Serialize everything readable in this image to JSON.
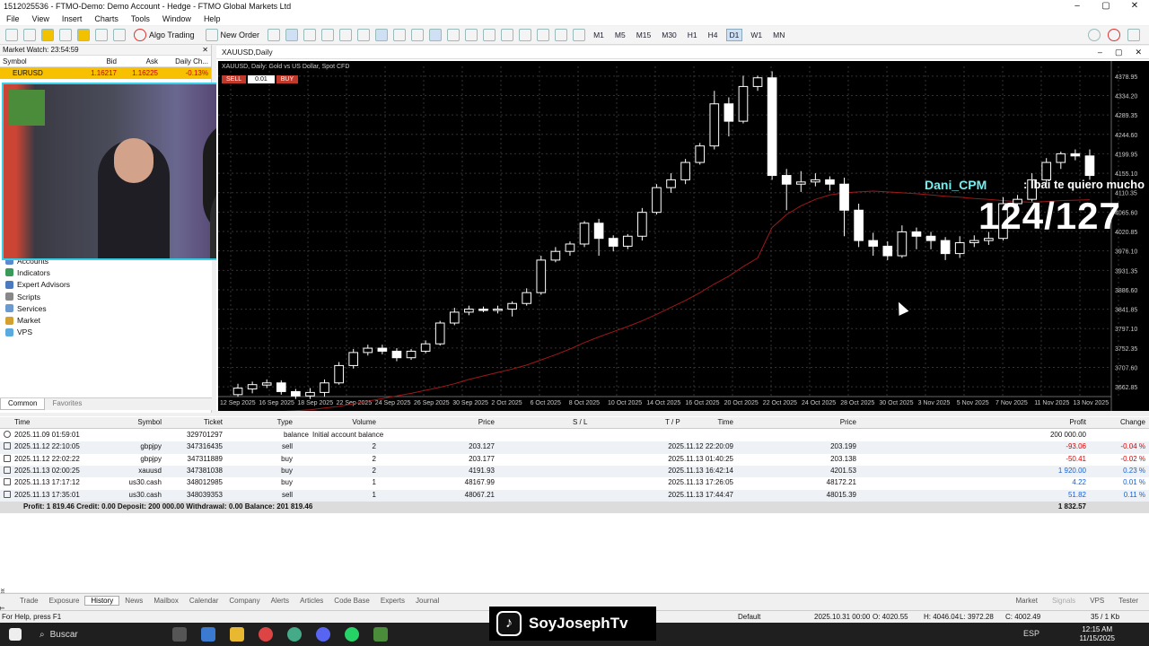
{
  "window": {
    "title": "1512025536 - FTMO-Demo: Demo Account - Hedge - FTMO Global Markets Ltd"
  },
  "menu": [
    "File",
    "View",
    "Insert",
    "Charts",
    "Tools",
    "Window",
    "Help"
  ],
  "toolbar": {
    "algo_label": "Algo Trading",
    "neworder_label": "New Order",
    "timeframes": [
      "M1",
      "M5",
      "M15",
      "M30",
      "H1",
      "H4",
      "D1",
      "W1",
      "MN"
    ],
    "active_tf": "D1"
  },
  "market_watch": {
    "header": "Market Watch: 23:54:59",
    "cols": [
      "Symbol",
      "Bid",
      "Ask",
      "Daily Ch..."
    ],
    "row": {
      "symbol": "EURUSD",
      "bid": "1.16217",
      "ask": "1.16225",
      "change": "-0.13%"
    }
  },
  "navigator": {
    "items": [
      "Accounts",
      "Indicators",
      "Expert Advisors",
      "Scripts",
      "Services",
      "Market",
      "VPS"
    ],
    "tabs": [
      "Common",
      "Favorites"
    ]
  },
  "chart_window": {
    "tab": "XAUUSD,Daily",
    "desc": "XAUUSD, Daily: Gold vs US Dollar, Spot CFD",
    "sell": "SELL",
    "buy": "BUY",
    "lot": "0.01"
  },
  "chart_data": {
    "type": "candlestick",
    "symbol": "XAUUSD",
    "x_labels": [
      "12 Sep 2025",
      "16 Sep 2025",
      "18 Sep 2025",
      "22 Sep 2025",
      "24 Sep 2025",
      "26 Sep 2025",
      "30 Sep 2025",
      "2 Oct 2025",
      "6 Oct 2025",
      "8 Oct 2025",
      "10 Oct 2025",
      "14 Oct 2025",
      "16 Oct 2025",
      "20 Oct 2025",
      "22 Oct 2025",
      "24 Oct 2025",
      "28 Oct 2025",
      "30 Oct 2025",
      "3 Nov 2025",
      "5 Nov 2025",
      "7 Nov 2025",
      "11 Nov 2025",
      "13 Nov 2025"
    ],
    "y_labels": [
      "4378.95",
      "4334.20",
      "4289.35",
      "4244.60",
      "4199.95",
      "4155.10",
      "4110.35",
      "4065.60",
      "4020.85",
      "3976.10",
      "3931.35",
      "3886.60",
      "3841.85",
      "3797.10",
      "3752.35",
      "3707.60",
      "3662.85"
    ],
    "ylim": [
      3640.48,
      4401.33
    ],
    "candles": [
      [
        3645,
        3660,
        3640,
        3670
      ],
      [
        3658,
        3668,
        3648,
        3675
      ],
      [
        3667,
        3672,
        3660,
        3680
      ],
      [
        3672,
        3652,
        3645,
        3678
      ],
      [
        3652,
        3642,
        3635,
        3658
      ],
      [
        3642,
        3650,
        3635,
        3660
      ],
      [
        3650,
        3672,
        3640,
        3680
      ],
      [
        3672,
        3712,
        3668,
        3720
      ],
      [
        3712,
        3742,
        3705,
        3750
      ],
      [
        3742,
        3752,
        3735,
        3760
      ],
      [
        3752,
        3745,
        3738,
        3760
      ],
      [
        3745,
        3730,
        3722,
        3752
      ],
      [
        3730,
        3745,
        3725,
        3750
      ],
      [
        3745,
        3762,
        3740,
        3770
      ],
      [
        3762,
        3810,
        3758,
        3815
      ],
      [
        3810,
        3835,
        3805,
        3845
      ],
      [
        3835,
        3842,
        3828,
        3850
      ],
      [
        3842,
        3840,
        3835,
        3848
      ],
      [
        3840,
        3842,
        3832,
        3850
      ],
      [
        3842,
        3855,
        3825,
        3860
      ],
      [
        3855,
        3880,
        3850,
        3890
      ],
      [
        3880,
        3955,
        3875,
        3965
      ],
      [
        3955,
        3975,
        3950,
        3985
      ],
      [
        3975,
        3992,
        3965,
        3998
      ],
      [
        3992,
        4040,
        3985,
        4045
      ],
      [
        4040,
        4005,
        3965,
        4050
      ],
      [
        4005,
        3987,
        3975,
        4012
      ],
      [
        3987,
        4010,
        3980,
        4015
      ],
      [
        4010,
        4065,
        4000,
        4075
      ],
      [
        4065,
        4122,
        4060,
        4130
      ],
      [
        4122,
        4140,
        4110,
        4155
      ],
      [
        4140,
        4180,
        4130,
        4188
      ],
      [
        4180,
        4218,
        4175,
        4225
      ],
      [
        4218,
        4315,
        4210,
        4345
      ],
      [
        4315,
        4275,
        4240,
        4330
      ],
      [
        4275,
        4355,
        4270,
        4380
      ],
      [
        4355,
        4375,
        4345,
        4380
      ],
      [
        4375,
        4150,
        4140,
        4390
      ],
      [
        4150,
        4130,
        4070,
        4165
      ],
      [
        4130,
        4135,
        4112,
        4160
      ],
      [
        4135,
        4140,
        4125,
        4155
      ],
      [
        4140,
        4130,
        4115,
        4148
      ],
      [
        4130,
        4070,
        4010,
        4145
      ],
      [
        4070,
        4000,
        3985,
        4085
      ],
      [
        4000,
        3987,
        3965,
        4018
      ],
      [
        3987,
        3965,
        3955,
        3998
      ],
      [
        3965,
        4020,
        3960,
        4035
      ],
      [
        4020,
        4010,
        3980,
        4030
      ],
      [
        4010,
        4000,
        3980,
        4020
      ],
      [
        4000,
        3970,
        3955,
        4008
      ],
      [
        3970,
        3995,
        3960,
        4010
      ],
      [
        3995,
        4000,
        3985,
        4012
      ],
      [
        4000,
        4005,
        3990,
        4020
      ],
      [
        4005,
        4085,
        4000,
        4100
      ],
      [
        4085,
        4095,
        4075,
        4105
      ],
      [
        4095,
        4140,
        4090,
        4155
      ],
      [
        4140,
        4180,
        4130,
        4190
      ],
      [
        4180,
        4200,
        4165,
        4205
      ],
      [
        4200,
        4195,
        4185,
        4210
      ],
      [
        4195,
        4150,
        4140,
        4210
      ]
    ],
    "ma": [
      3600,
      3602,
      3604,
      3606,
      3608,
      3610,
      3614,
      3618,
      3624,
      3630,
      3636,
      3642,
      3648,
      3655,
      3662,
      3670,
      3680,
      3688,
      3696,
      3704,
      3713,
      3725,
      3737,
      3750,
      3765,
      3778,
      3790,
      3802,
      3815,
      3830,
      3846,
      3862,
      3880,
      3900,
      3918,
      3940,
      3960,
      4030,
      4060,
      4080,
      4095,
      4105,
      4110,
      4112,
      4114,
      4112,
      4110,
      4108,
      4105,
      4102,
      4100,
      4097,
      4095,
      4092,
      4090,
      4088,
      4090,
      4092,
      4093,
      4094
    ]
  },
  "overlay": {
    "name": "Dani_CPM",
    "message": ": Ibai te quiero mucho",
    "count": "124/127"
  },
  "history": {
    "cols": [
      "Time",
      "Symbol",
      "Ticket",
      "Type",
      "Volume",
      "Price",
      "S / L",
      "T / P",
      "Time",
      "Price",
      "Profit",
      "Change"
    ],
    "rows": [
      [
        "2025.11.09 01:59:01",
        "",
        "329701297",
        "balance",
        "Initial account balance",
        "",
        "",
        "",
        "",
        "",
        "200 000.00",
        ""
      ],
      [
        "2025.11.12 22:10:05",
        "gbpjpy",
        "347316435",
        "sell",
        "2",
        "203.127",
        "",
        "",
        "2025.11.12 22:20:09",
        "203.199",
        "-93.06",
        "-0.04 %"
      ],
      [
        "2025.11.12 22:02:22",
        "gbpjpy",
        "347311889",
        "buy",
        "2",
        "203.177",
        "",
        "",
        "2025.11.13 01:40:25",
        "203.138",
        "-50.41",
        "-0.02 %"
      ],
      [
        "2025.11.13 02:00:25",
        "xauusd",
        "347381038",
        "buy",
        "2",
        "4191.93",
        "",
        "",
        "2025.11.13 16:42:14",
        "4201.53",
        "1 920.00",
        "0.23 %"
      ],
      [
        "2025.11.13 17:17:12",
        "us30.cash",
        "348012985",
        "buy",
        "1",
        "48167.99",
        "",
        "",
        "2025.11.13 17:26:05",
        "48172.21",
        "4.22",
        "0.01 %"
      ],
      [
        "2025.11.13 17:35:01",
        "us30.cash",
        "348039353",
        "sell",
        "1",
        "48067.21",
        "",
        "",
        "2025.11.13 17:44:47",
        "48015.39",
        "51.82",
        "0.11 %"
      ]
    ],
    "summary": "Profit: 1 819.46  Credit: 0.00  Deposit: 200 000.00  Withdrawal: 0.00  Balance: 201 819.46",
    "summary_profit": "1 832.57"
  },
  "bottom_tabs": [
    "Trade",
    "Exposure",
    "History",
    "News",
    "Mailbox",
    "Calendar",
    "Company",
    "Alerts",
    "Articles",
    "Code Base",
    "Experts",
    "Journal"
  ],
  "bottom_right": [
    "Market",
    "Signals",
    "VPS",
    "Tester"
  ],
  "toolbox_label": "Toolbox",
  "status": {
    "help": "For Help, press F1",
    "profile": "Default",
    "time": "2025.10.31 00:00",
    "o": "O: 4020.55",
    "h": "H: 4046.04",
    "l": "L: 3972.28",
    "c": "C: 4002.49",
    "traffic": "35 / 1 Kb"
  },
  "taskbar": {
    "search": "Buscar",
    "tiktok": "SoyJosephTv",
    "lang": "ESP",
    "clock_time": "12:15 AM",
    "clock_date": "11/15/2025"
  }
}
